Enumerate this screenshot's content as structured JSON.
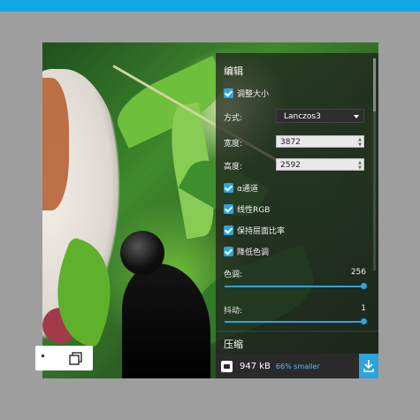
{
  "section_title": "编辑",
  "options": {
    "resize_label": "调整大小",
    "method_label": "方式:",
    "method_value": "Lanczos3",
    "width_label": "宽度:",
    "width_value": "3872",
    "height_label": "高度:",
    "height_value": "2592",
    "alpha_label": "α通道",
    "linear_rgb_label": "线性RGB",
    "keep_ratio_label": "保持层面比率",
    "reduce_palette_label": "降低色调"
  },
  "sliders": {
    "colors_label": "色调:",
    "colors_value": "256",
    "colors_fraction": 1.0,
    "dither_label": "抖动:",
    "dither_value": "1",
    "dither_fraction": 1.0
  },
  "compress_title": "压缩",
  "stats": {
    "size": "947 kB",
    "savings": "66% smaller"
  },
  "colors": {
    "accent": "#2ea3dc",
    "topbar": "#11a7e6",
    "savings_text": "#4fc3f7"
  }
}
